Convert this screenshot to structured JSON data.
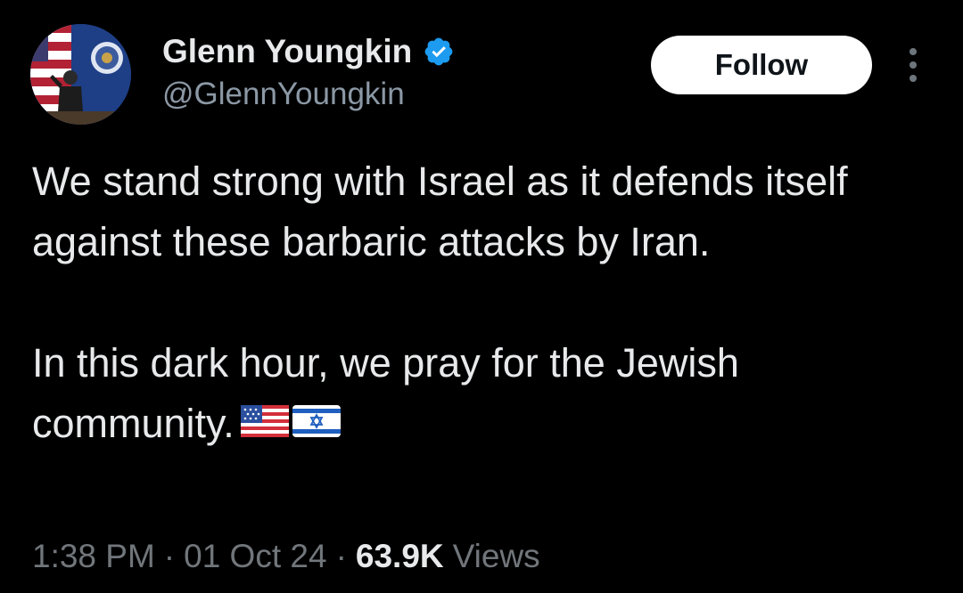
{
  "author": {
    "display_name": "Glenn Youngkin",
    "handle": "@GlennYoungkin",
    "verified_badge": "verified-badge-icon",
    "avatar_icon": "profile-photo"
  },
  "follow_button": {
    "label": "Follow"
  },
  "more_menu": {
    "icon": "more-vertical-icon"
  },
  "tweet": {
    "paragraphs": [
      "We stand strong with Israel as it defends itself against these barbaric attacks by Iran.",
      "In this dark hour, we pray for the Jewish community."
    ],
    "emojis": [
      "us-flag-icon",
      "israel-flag-icon"
    ]
  },
  "meta": {
    "time": "1:38 PM",
    "separator": "·",
    "date": "01 Oct 24",
    "views_count": "63.9K",
    "views_label": "Views"
  },
  "colors": {
    "background": "#000000",
    "text_primary": "#e7e9ea",
    "text_secondary": "#71767b",
    "verified_blue": "#1d9bf0",
    "follow_bg": "#ffffff"
  }
}
